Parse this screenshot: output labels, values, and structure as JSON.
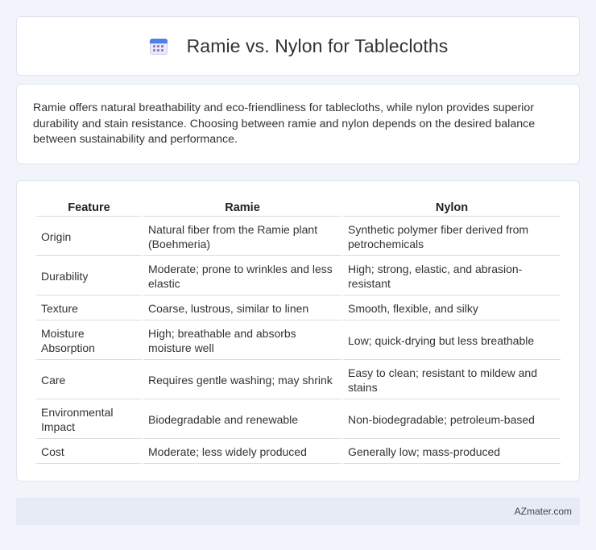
{
  "header": {
    "title": "Ramie vs. Nylon for Tablecloths",
    "icon": "calendar-icon"
  },
  "summary": {
    "text": "Ramie offers natural breathability and eco-friendliness for tablecloths, while nylon provides superior durability and stain resistance. Choosing between ramie and nylon depends on the desired balance between sustainability and performance."
  },
  "table": {
    "headers": [
      "Feature",
      "Ramie",
      "Nylon"
    ],
    "rows": [
      {
        "feature": "Origin",
        "ramie": "Natural fiber from the Ramie plant (Boehmeria)",
        "nylon": "Synthetic polymer fiber derived from petrochemicals"
      },
      {
        "feature": "Durability",
        "ramie": "Moderate; prone to wrinkles and less elastic",
        "nylon": "High; strong, elastic, and abrasion-resistant"
      },
      {
        "feature": "Texture",
        "ramie": "Coarse, lustrous, similar to linen",
        "nylon": "Smooth, flexible, and silky"
      },
      {
        "feature": "Moisture Absorption",
        "ramie": "High; breathable and absorbs moisture well",
        "nylon": "Low; quick-drying but less breathable"
      },
      {
        "feature": "Care",
        "ramie": "Requires gentle washing; may shrink",
        "nylon": "Easy to clean; resistant to mildew and stains"
      },
      {
        "feature": "Environmental Impact",
        "ramie": "Biodegradable and renewable",
        "nylon": "Non-biodegradable; petroleum-based"
      },
      {
        "feature": "Cost",
        "ramie": "Moderate; less widely produced",
        "nylon": "Generally low; mass-produced"
      }
    ]
  },
  "footer": {
    "brand": "AZmater.com"
  }
}
